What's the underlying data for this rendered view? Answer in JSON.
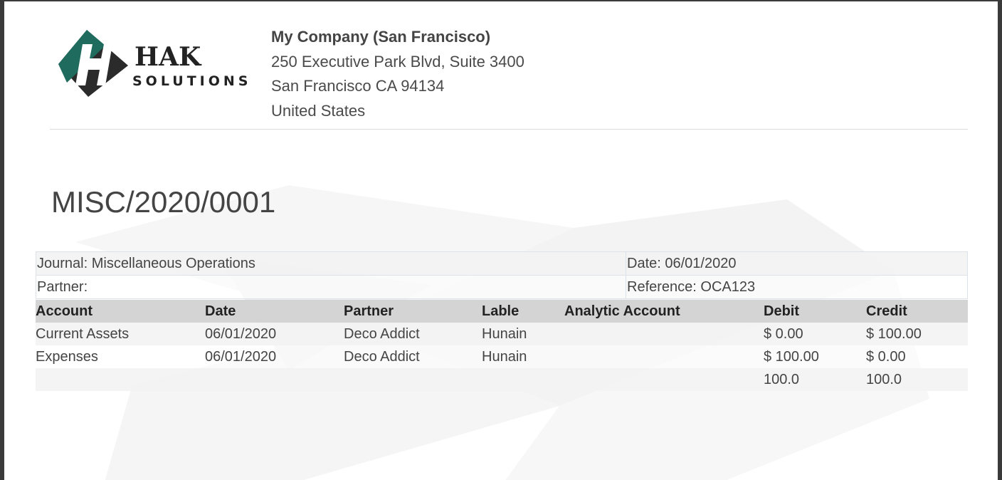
{
  "logo": {
    "line1": "HAK",
    "line2": "SOLUTIONS",
    "colors": {
      "teal": "#1f6b5e",
      "dark": "#2b2b2b"
    }
  },
  "company": {
    "name": "My Company (San Francisco)",
    "address_line1": "250 Executive Park Blvd, Suite 3400",
    "address_line2": "San Francisco CA 94134",
    "country": "United States"
  },
  "document": {
    "title": "MISC/2020/0001"
  },
  "info": {
    "journal": "Journal: Miscellaneous Operations",
    "date": "Date: 06/01/2020",
    "partner": "Partner:",
    "reference": "Reference: OCA123"
  },
  "lines": {
    "headers": {
      "account": "Account",
      "date": "Date",
      "partner": "Partner",
      "label": "Lable",
      "analytic": "Analytic Account",
      "debit": "Debit",
      "credit": "Credit"
    },
    "rows": [
      {
        "account": "Current Assets",
        "date": "06/01/2020",
        "partner": "Deco Addict",
        "label": "Hunain",
        "analytic": "",
        "debit": "$ 0.00",
        "credit": "$ 100.00"
      },
      {
        "account": "Expenses",
        "date": "06/01/2020",
        "partner": "Deco Addict",
        "label": "Hunain",
        "analytic": "",
        "debit": "$ 100.00",
        "credit": "$ 0.00"
      }
    ],
    "totals": {
      "debit": "100.0",
      "credit": "100.0"
    }
  }
}
